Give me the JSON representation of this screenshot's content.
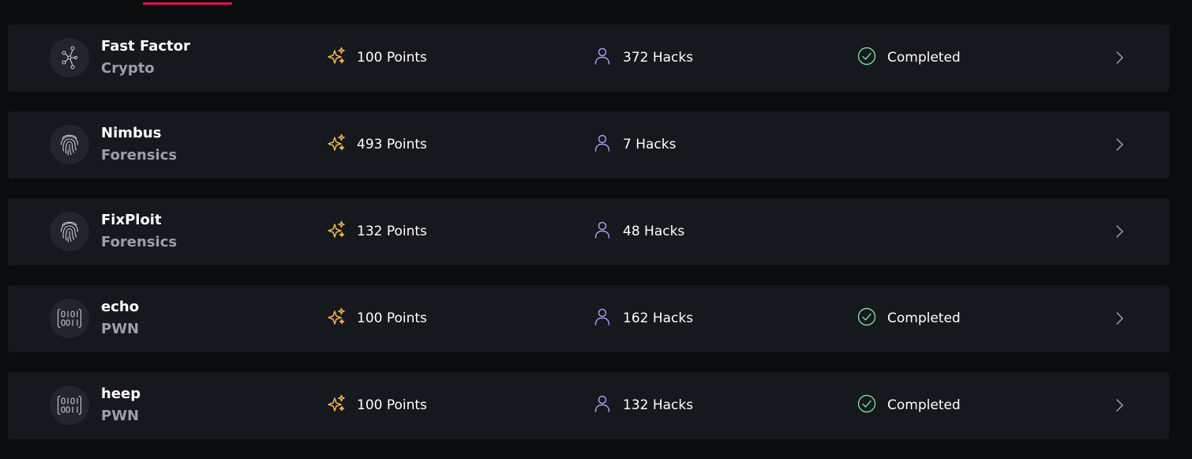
{
  "colors": {
    "background": "#0b0c0e",
    "row_background": "#15181c",
    "tab_accent": "#e0144c",
    "points_icon": "#f2b44d",
    "hacks_icon": "#a79af2",
    "completed_icon": "#7ddc9b",
    "text_primary": "#ffffff",
    "text_secondary": "#9aa0a6"
  },
  "challenges": [
    {
      "name": "Fast Factor",
      "category": "Crypto",
      "category_icon": "nodes-icon",
      "points": "100 Points",
      "hacks": "372 Hacks",
      "status": "Completed"
    },
    {
      "name": "Nimbus",
      "category": "Forensics",
      "category_icon": "fingerprint-icon",
      "points": "493 Points",
      "hacks": "7 Hacks",
      "status": ""
    },
    {
      "name": "FixPloit",
      "category": "Forensics",
      "category_icon": "fingerprint-icon",
      "points": "132 Points",
      "hacks": "48 Hacks",
      "status": ""
    },
    {
      "name": "echo",
      "category": "PWN",
      "category_icon": "binary-icon",
      "points": "100 Points",
      "hacks": "162 Hacks",
      "status": "Completed"
    },
    {
      "name": "heep",
      "category": "PWN",
      "category_icon": "binary-icon",
      "points": "100 Points",
      "hacks": "132 Hacks",
      "status": "Completed"
    }
  ]
}
